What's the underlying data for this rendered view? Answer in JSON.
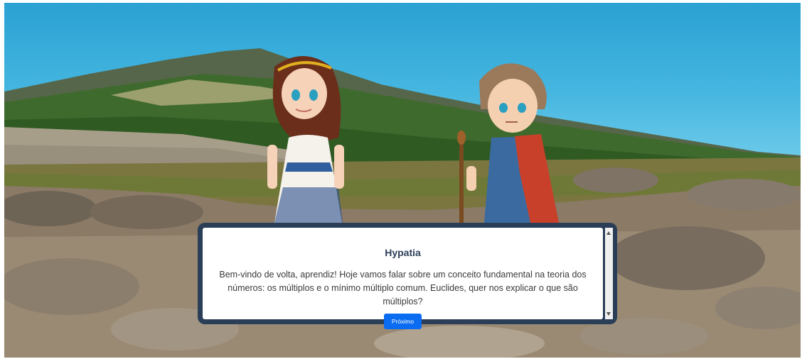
{
  "scene": {
    "background": "mountain-rocky-meadow-landscape",
    "characters": [
      "hypatia-character",
      "euclides-character"
    ]
  },
  "dialog": {
    "speaker": "Hypatia",
    "text": "Bem-vindo de volta, aprendiz! Hoje vamos falar sobre um conceito fundamental na teoria dos números: os múltiplos e o mínimo múltiplo comum. Euclides, quer nos explicar o que são múltiplos?",
    "next_label": "Próximo"
  },
  "colors": {
    "sky": "#45b6e0",
    "dialog_frame": "#2b3e57",
    "button": "#0a6cf0"
  }
}
